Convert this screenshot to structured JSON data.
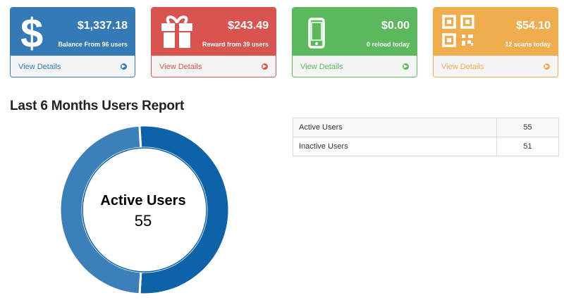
{
  "cards": {
    "balance": {
      "amount": "$1,337.18",
      "subtitle": "Balance From 96 users",
      "link": "View Details",
      "icon": "dollar-icon",
      "color": "#337ab7"
    },
    "reward": {
      "amount": "$243.49",
      "subtitle": "Reward from 39 users",
      "link": "View Details",
      "icon": "gift-icon",
      "color": "#d9534f"
    },
    "reload": {
      "amount": "$0.00",
      "subtitle": "0 reload today",
      "link": "View Details",
      "icon": "mobile-phone-icon",
      "color": "#5cb85c"
    },
    "scans": {
      "amount": "$54.10",
      "subtitle": "12 scans today",
      "link": "View Details",
      "icon": "qr-code-icon",
      "color": "#f0ad4e"
    }
  },
  "report": {
    "title": "Last 6 Months Users Report"
  },
  "chart_data": {
    "type": "pie",
    "categories": [
      "Active Users",
      "Inactive Users"
    ],
    "values": [
      55,
      51
    ],
    "colors": [
      "#0e63a8",
      "#3b80b8"
    ],
    "center_label": "Active Users",
    "center_value": "55",
    "title": ""
  },
  "table": {
    "rows": [
      {
        "label": "Active Users",
        "value": "55"
      },
      {
        "label": "Inactive Users",
        "value": "51"
      }
    ]
  }
}
